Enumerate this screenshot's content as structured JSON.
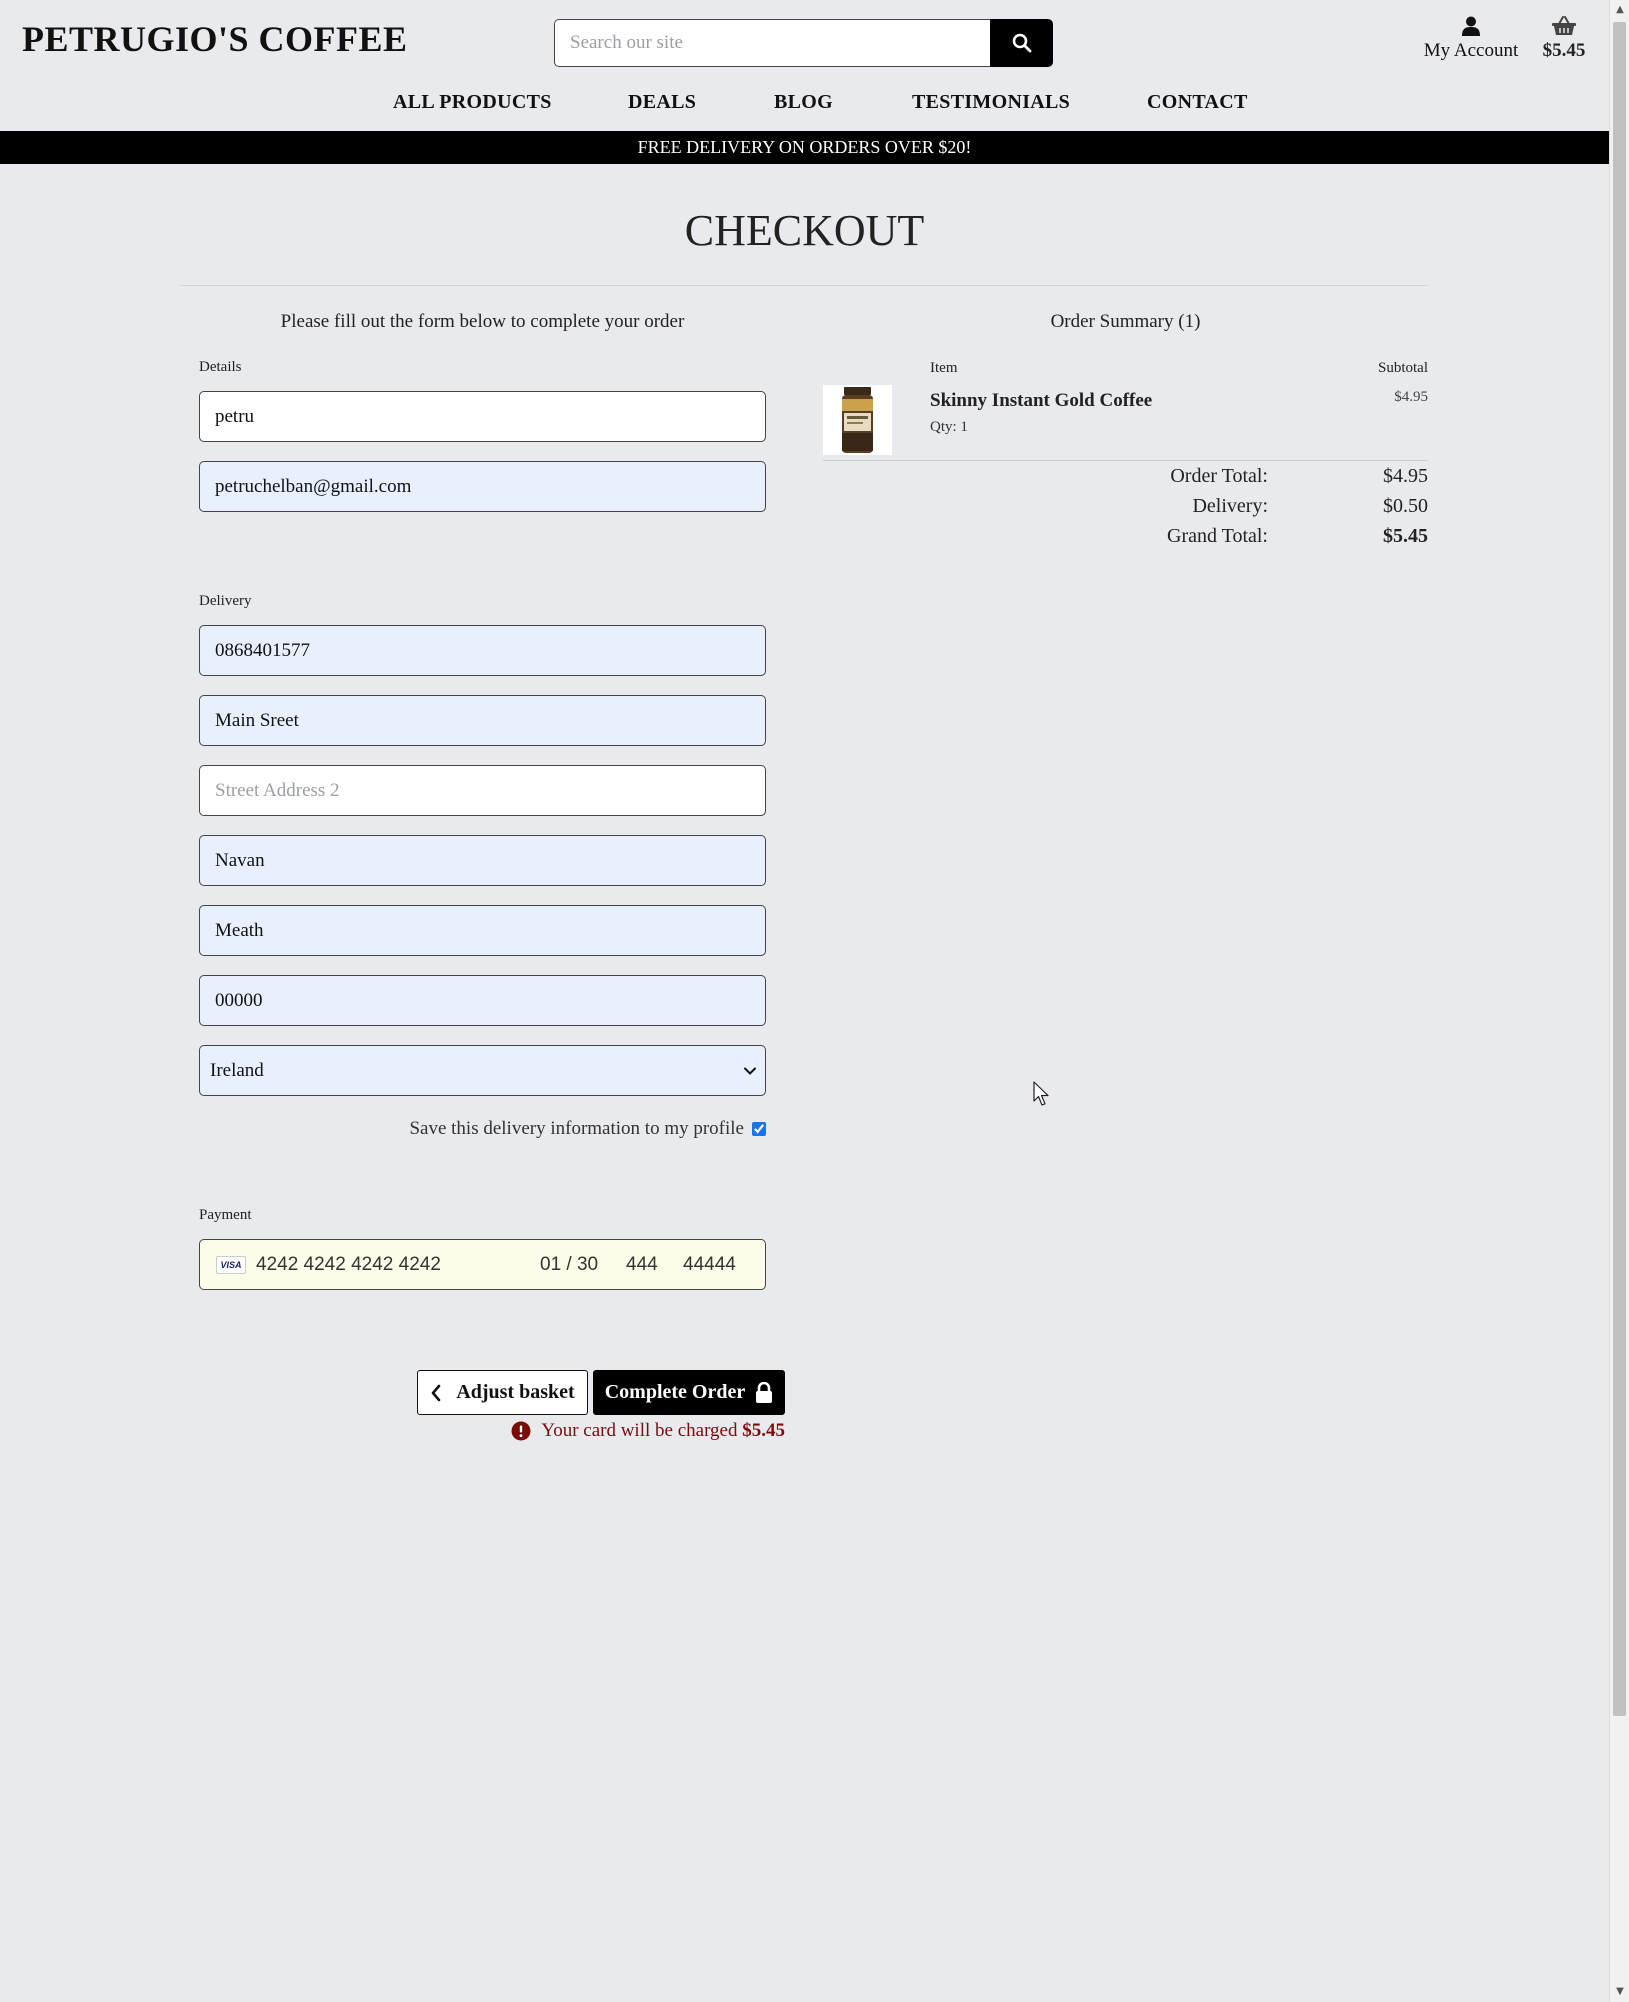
{
  "header": {
    "brand": "PETRUGIO'S COFFEE",
    "search_placeholder": "Search our site",
    "account_label": "My Account",
    "basket_total": "$5.45"
  },
  "nav": [
    "ALL PRODUCTS",
    "DEALS",
    "BLOG",
    "TESTIMONIALS",
    "CONTACT"
  ],
  "banner": "FREE DELIVERY ON ORDERS OVER $20!",
  "page_title": "CHECKOUT",
  "form": {
    "intro": "Please fill out the form below to complete your order",
    "details_legend": "Details",
    "full_name": "petru",
    "email": "petruchelban@gmail.com",
    "delivery_legend": "Delivery",
    "phone": "0868401577",
    "street1": "Main Sreet",
    "street2_placeholder": "Street Address 2",
    "town": "Navan",
    "county": "Meath",
    "postcode": "00000",
    "country": "Ireland",
    "save_info_label": "Save this delivery information to my profile",
    "save_info_checked": true,
    "payment_legend": "Payment",
    "card": {
      "brand": "VISA",
      "number": "4242 4242 4242 4242",
      "expiry": "01 / 30",
      "cvc": "444",
      "zip": "44444"
    },
    "adjust_label": "Adjust basket",
    "complete_label": "Complete Order",
    "charge_text": "Your card will be charged",
    "charge_amount": "$5.45"
  },
  "summary": {
    "title": "Order Summary (1)",
    "col_item": "Item",
    "col_subtotal": "Subtotal",
    "items": [
      {
        "name": "Skinny Instant Gold Coffee",
        "qty": "Qty: 1",
        "subtotal": "$4.95"
      }
    ],
    "order_total_label": "Order Total:",
    "order_total": "$4.95",
    "delivery_label": "Delivery:",
    "delivery": "$0.50",
    "grand_total_label": "Grand Total:",
    "grand_total": "$5.45"
  },
  "colors": {
    "background": "#e9eaed",
    "autofill": "#e8f0fe",
    "card_field": "#fefde9",
    "error_text": "#7a0c0c",
    "banner": "#000000"
  }
}
